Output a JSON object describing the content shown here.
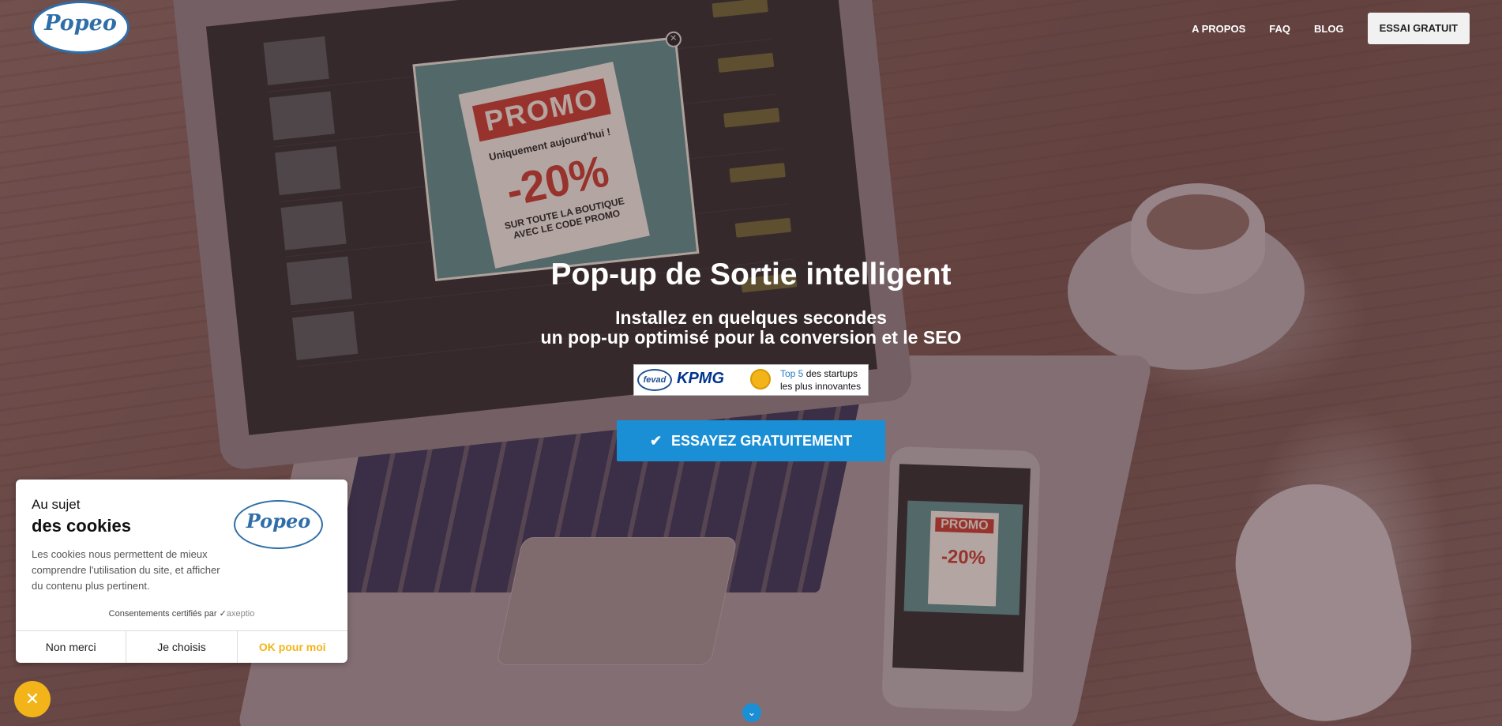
{
  "header": {
    "logo_text": "Popeo",
    "nav": [
      "A PROPOS",
      "FAQ",
      "BLOG"
    ],
    "cta": "ESSAI GRATUIT"
  },
  "hero": {
    "title": "Pop-up de Sortie intelligent",
    "subtitle_line1": "Installez en quelques secondes",
    "subtitle_line2": "un pop-up optimisé pour la conversion et le SEO",
    "badge": {
      "fevad": "fevad",
      "kpmg": "KPMG",
      "top5": "Top 5",
      "line1_rest": " des startups",
      "line2": "les plus innovantes"
    },
    "cta": "ESSAYEZ GRATUITEMENT"
  },
  "mockup": {
    "promo_tag": "PROMO",
    "promo_sub": "Uniquement aujourd'hui !",
    "promo_big": "-20%",
    "promo_foot": "SUR TOUTE LA BOUTIQUE AVEC LE CODE PROMO",
    "phone_promo_tag": "PROMO",
    "phone_promo_big": "-20%"
  },
  "cookie": {
    "title_line1": "Au sujet",
    "title_line2": "des cookies",
    "logo_text": "Popeo",
    "body": "Les cookies nous permettent de mieux comprendre l'utilisation du site, et afficher du contenu plus pertinent.",
    "cert_prefix": "Consentements certifiés par",
    "cert_brand": "axeptio",
    "buttons": [
      "Non merci",
      "Je choisis",
      "OK pour moi"
    ]
  },
  "colors": {
    "accent_blue": "#1a8fd6",
    "cookie_yellow": "#f2b418",
    "logo_blue": "#2f6ea8"
  },
  "icons": [
    "check-icon",
    "close-icon",
    "chevron-down-icon"
  ]
}
